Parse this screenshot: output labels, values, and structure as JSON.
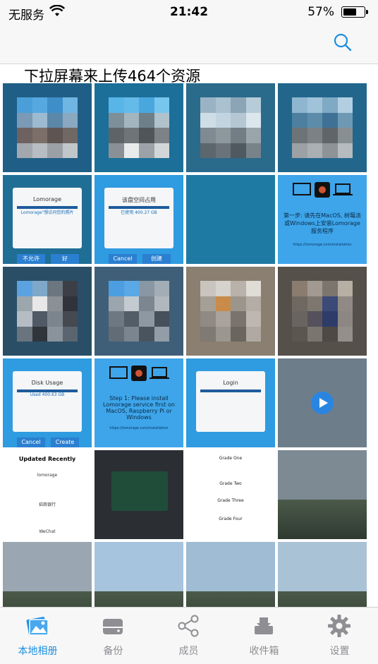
{
  "status_bar": {
    "carrier": "无服务",
    "time": "21:42",
    "battery_percent": "57%"
  },
  "navbar": {
    "search_icon": "search-icon"
  },
  "pull_hint": "下拉屏幕来上传464个资源",
  "photos": [
    {
      "kind": "mosaic",
      "bg": "#1f5e86",
      "colors": [
        "#4a9fd8",
        "#56a8e0",
        "#3e8ec9",
        "#6fb6e3",
        "#7a9ab5",
        "#9cbad0",
        "#5b87a8",
        "#8aa9c0",
        "#6d6260",
        "#7c6f6a",
        "#5e5552",
        "#706864",
        "#a2a8ad",
        "#b7bdc2",
        "#9aa0a5",
        "#c1c6ca"
      ]
    },
    {
      "kind": "mosaic",
      "bg": "#1c6f98",
      "colors": [
        "#58b5e8",
        "#64bbea",
        "#4aa7de",
        "#77c6ee",
        "#7e8f99",
        "#a3b6c0",
        "#6e7f89",
        "#b0c3cc",
        "#5d6468",
        "#6f7478",
        "#4f5559",
        "#7c8286",
        "#8a9095",
        "#e8eaec",
        "#9ca2a7",
        "#d3d6d8"
      ]
    },
    {
      "kind": "mosaic",
      "bg": "#2a6a8a",
      "colors": [
        "#9ab3c4",
        "#aac1d0",
        "#8ca5b6",
        "#b7ccd9",
        "#cfdde6",
        "#c2d4df",
        "#b4c7d3",
        "#dbe6ed",
        "#7f8a92",
        "#8d979e",
        "#727d85",
        "#9aa4ab",
        "#5c666d",
        "#6a737a",
        "#4f5960",
        "#78828a"
      ]
    },
    {
      "kind": "mosaic",
      "bg": "#22668c",
      "colors": [
        "#8fb6cf",
        "#a0c3d9",
        "#7fa9c4",
        "#b1cfe1",
        "#4d7fa0",
        "#5d8cab",
        "#3e7195",
        "#6e99b5",
        "#6d7478",
        "#7b8286",
        "#5f666a",
        "#888f93",
        "#9ba1a5",
        "#a9afb3",
        "#8d9397",
        "#b5bbbf"
      ]
    },
    {
      "kind": "ui",
      "bg": "#1f6e96",
      "text": "Lomorage",
      "text2": "Lomorage\"想访问您的照片",
      "text3": "不允许",
      "text4": "好"
    },
    {
      "kind": "ui",
      "bg": "#2f9be0",
      "text": "该盘空间占用",
      "text2": "已使用 400.27 GB",
      "text3": "Cancel",
      "text4": "创建"
    },
    {
      "kind": "plain",
      "bg": "#1f7aa3",
      "text": ""
    },
    {
      "kind": "ui",
      "bg": "#3ea5ea",
      "text": "第一步: 请先在MacOS, 树莓派或Windows上安装Lomorage服务程序",
      "text2": "https://lomorage.com/installation",
      "text3": "",
      "text4": ""
    },
    {
      "kind": "mosaic",
      "bg": "#2a4e66",
      "colors": [
        "#5aa3e0",
        "#7fa8c8",
        "#6b7680",
        "#3c4046",
        "#9ca6ad",
        "#e8e8e8",
        "#8b9096",
        "#30343a",
        "#b5bcc4",
        "#4f5a66",
        "#7c858e",
        "#444a50",
        "#6a747e",
        "#2f353b",
        "#8a939b",
        "#5b656f"
      ]
    },
    {
      "kind": "mosaic",
      "bg": "#3f5f78",
      "colors": [
        "#4c9ee0",
        "#5aa8e6",
        "#8897a3",
        "#a2adb6",
        "#9aa5ae",
        "#c3cad0",
        "#7b8690",
        "#b0b8be",
        "#6d7883",
        "#535d67",
        "#8d98a2",
        "#45505a",
        "#616c76",
        "#7a858f",
        "#4a545e",
        "#929da7"
      ]
    },
    {
      "kind": "mosaic",
      "bg": "#8a7f70",
      "colors": [
        "#c9c4bd",
        "#d6d2cc",
        "#b8b2aa",
        "#e0dcd6",
        "#a59f96",
        "#c98b4a",
        "#9c958c",
        "#b3ada5",
        "#8f8a83",
        "#a9a39b",
        "#78736c",
        "#bdb7af",
        "#7f7a73",
        "#9b968f",
        "#6a655f",
        "#afa9a1"
      ]
    },
    {
      "kind": "mosaic",
      "bg": "#55504a",
      "colors": [
        "#8a7d70",
        "#a29a92",
        "#7c756e",
        "#b7aea4",
        "#6f6860",
        "#7d7770",
        "#3c4a78",
        "#8f8a85",
        "#6a6460",
        "#55515c",
        "#2e3c6a",
        "#8c8782",
        "#5b5650",
        "#7a756f",
        "#4d4944",
        "#948f89"
      ]
    },
    {
      "kind": "ui",
      "bg": "#2f9be0",
      "text": "Disk Usage",
      "text2": "Used 400.63 GB",
      "text3": "Cancel",
      "text4": "Create"
    },
    {
      "kind": "ui",
      "bg": "#3ea5ea",
      "text": "Step 1: Please install Lomorage service first on MacOS, Raspberry Pi or Windows",
      "text2": "https://lomorage.com/installation",
      "text3": "",
      "text4": ""
    },
    {
      "kind": "ui",
      "bg": "#2f9be0",
      "text": "Login",
      "text2": "",
      "text3": "",
      "text4": ""
    },
    {
      "kind": "video",
      "bg": "#6d7e8a",
      "text": ""
    },
    {
      "kind": "list",
      "bg": "#ffffff",
      "text": "Updated Recently",
      "text2": "lomorage",
      "text3": "招商银行",
      "text4": "WeChat"
    },
    {
      "kind": "photo",
      "bg": "#2b2f33",
      "text": ""
    },
    {
      "kind": "grades",
      "bg": "#ffffff",
      "text": "Grade One",
      "text2": "Grade Two",
      "text3": "Grade Three",
      "text4": "Grade Four"
    },
    {
      "kind": "landscape",
      "bg": "#7d8a94",
      "text": ""
    },
    {
      "kind": "landscape",
      "bg": "#9aa7b2",
      "text": ""
    },
    {
      "kind": "landscape",
      "bg": "#a7c4de",
      "text": ""
    },
    {
      "kind": "landscape",
      "bg": "#9fbcd4",
      "text": ""
    },
    {
      "kind": "landscape",
      "bg": "#a9c2d6",
      "text": ""
    }
  ],
  "tabs": [
    {
      "label": "本地相册",
      "icon": "photos-icon",
      "active": true
    },
    {
      "label": "备份",
      "icon": "drive-icon",
      "active": false
    },
    {
      "label": "成员",
      "icon": "share-icon",
      "active": false
    },
    {
      "label": "收件箱",
      "icon": "inbox-icon",
      "active": false
    },
    {
      "label": "设置",
      "icon": "gear-icon",
      "active": false
    }
  ],
  "colors": {
    "accent": "#1a8fe3",
    "tab_inactive": "#8e8e93"
  }
}
